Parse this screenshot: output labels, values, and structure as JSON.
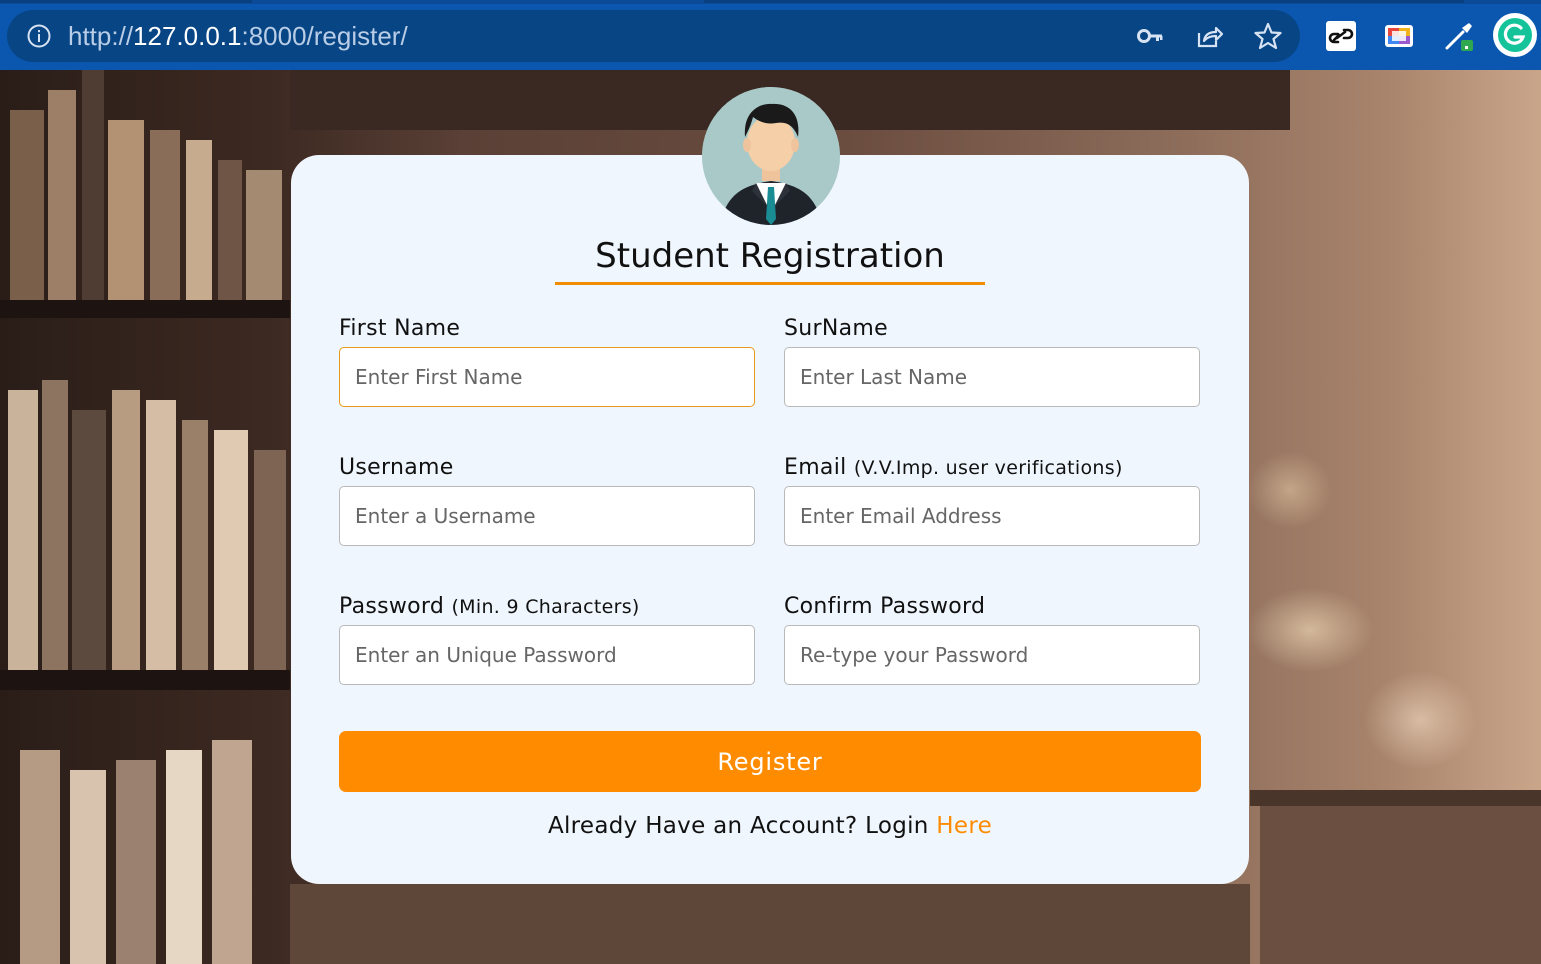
{
  "browser": {
    "url_scheme": "http://",
    "url_host": "127.0.0.1",
    "url_path": ":8000/register/"
  },
  "icons": {
    "info": "info-icon",
    "key": "key-icon",
    "share": "share-icon",
    "bookmark": "star-icon",
    "extensions": [
      "link-extension-icon",
      "color-palette-extension-icon",
      "eyedropper-extension-icon",
      "grammarly-icon"
    ]
  },
  "form": {
    "avatar": "student-avatar",
    "title": "Student Registration",
    "first_name": {
      "label": "First Name",
      "placeholder": "Enter First Name"
    },
    "surname": {
      "label": "SurName",
      "placeholder": "Enter Last Name"
    },
    "username": {
      "label": "Username",
      "placeholder": "Enter a Username"
    },
    "email": {
      "label": "Email",
      "note": "(V.V.Imp. user verifications)",
      "placeholder": "Enter Email Address"
    },
    "password": {
      "label": "Password",
      "note": "(Min. 9 Characters)",
      "placeholder": "Enter an Unique Password"
    },
    "confirm_password": {
      "label": "Confirm Password",
      "placeholder": "Re-type your Password"
    },
    "submit_label": "Register",
    "login_prompt": "Already Have an Account? Login",
    "login_link": "Here"
  },
  "colors": {
    "accent": "#ff8c00",
    "card_bg": "#eff6fd",
    "chrome_bg": "#0b57b0"
  }
}
